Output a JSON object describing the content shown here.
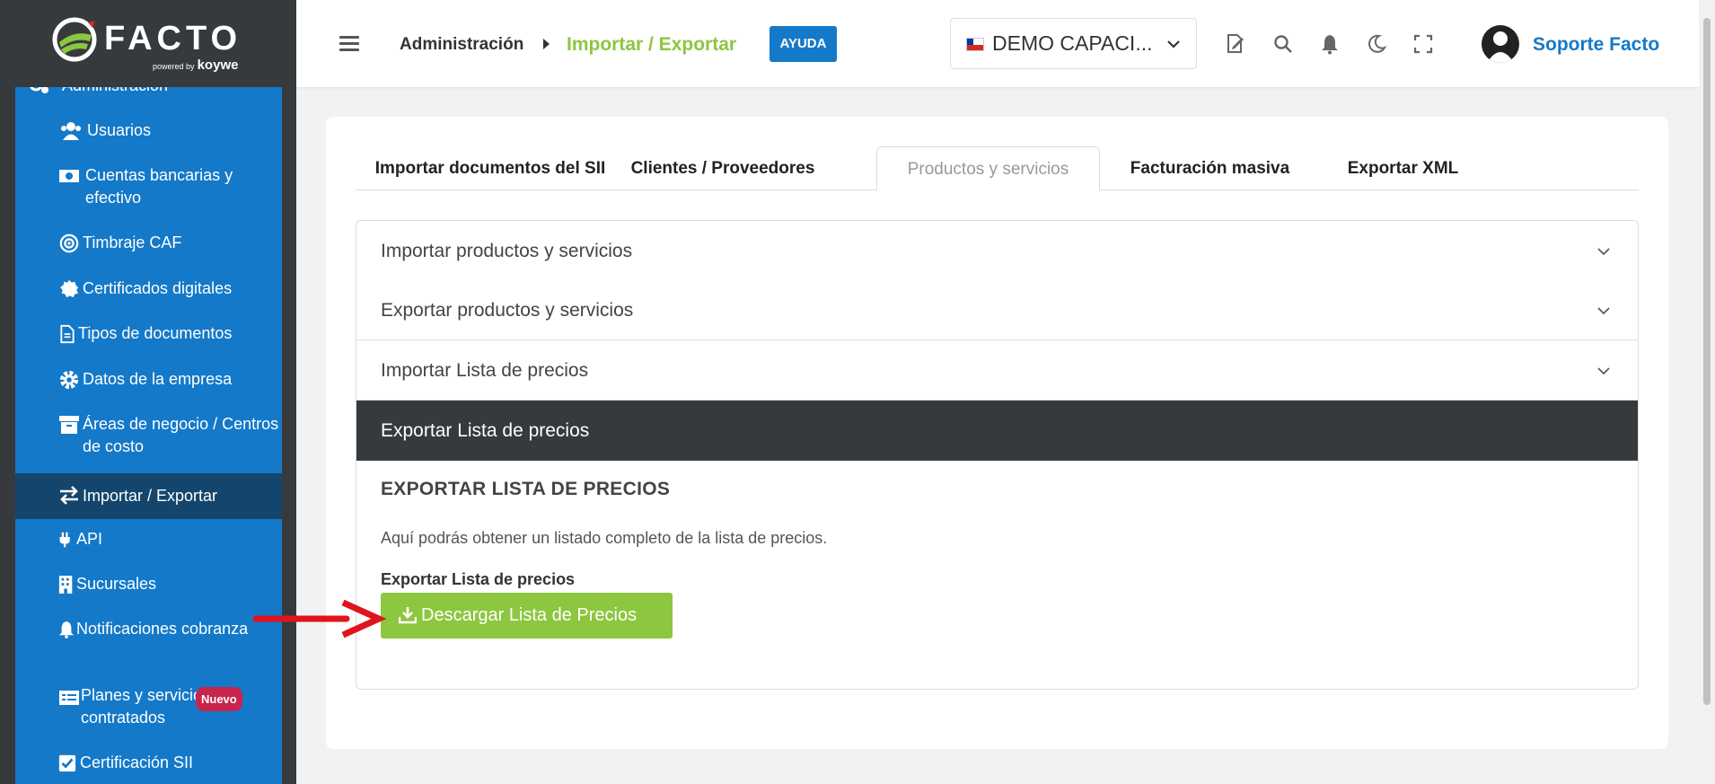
{
  "brand": {
    "logo_text": "FACTO",
    "powered_by": "powered by",
    "partner": "koywe",
    "colors": {
      "sidebar_dark": "#363a3d",
      "sidebar_blue": "#1479c9",
      "accent_green": "#8dc63f",
      "active_item": "#14466d"
    }
  },
  "sidebar": {
    "section_label": "Administración",
    "items": [
      {
        "label": "Usuarios",
        "icon": "users-icon"
      },
      {
        "label": "Cuentas bancarias y efectivo",
        "icon": "money-icon"
      },
      {
        "label": "Timbraje CAF",
        "icon": "target-icon"
      },
      {
        "label": "Certificados digitales",
        "icon": "certificate-icon"
      },
      {
        "label": "Tipos de documentos",
        "icon": "file-icon"
      },
      {
        "label": "Datos de la empresa",
        "icon": "gear-icon"
      },
      {
        "label": "Áreas de negocio / Centros de costo",
        "icon": "archive-icon"
      },
      {
        "label": "Importar / Exportar",
        "icon": "exchange-icon",
        "active": true
      },
      {
        "label": "API",
        "icon": "plug-icon"
      },
      {
        "label": "Sucursales",
        "icon": "building-icon"
      },
      {
        "label": "Notificaciones cobranza",
        "icon": "bell-icon"
      },
      {
        "label": "Planes y servicios contratados",
        "icon": "receipt-icon",
        "badge": "Nuevo"
      },
      {
        "label": "Certificación SII",
        "icon": "check-square-icon"
      }
    ]
  },
  "header": {
    "breadcrumb_parent": "Administración",
    "breadcrumb_current": "Importar / Exportar",
    "help_button": "AYUDA",
    "company_selector": "DEMO CAPACI...",
    "user_name": "Soporte Facto"
  },
  "tabs": [
    {
      "label": "Importar documentos del SII"
    },
    {
      "label": "Clientes / Proveedores"
    },
    {
      "label": "Productos y servicios",
      "active": true
    },
    {
      "label": "Facturación masiva"
    },
    {
      "label": "Exportar XML"
    }
  ],
  "accordion": {
    "panels": [
      {
        "label": "Importar productos y servicios"
      },
      {
        "label": "Exportar productos y servicios"
      },
      {
        "label": "Importar Lista de precios"
      },
      {
        "label": "Exportar Lista de precios",
        "open": true
      }
    ],
    "open_panel": {
      "title": "EXPORTAR LISTA DE PRECIOS",
      "description": "Aquí podrás obtener un listado completo de la lista de precios.",
      "field_label": "Exportar Lista de precios",
      "button_label": "Descargar Lista de Precios"
    }
  }
}
